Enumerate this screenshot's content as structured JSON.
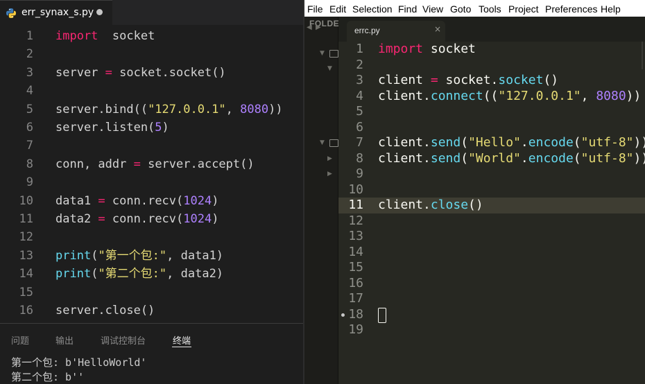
{
  "vscode": {
    "tab_label": "err_synax_s.py",
    "editor_lines": [
      {
        "n": "1",
        "t": [
          [
            "kw",
            "import"
          ],
          [
            "",
            "  socket"
          ]
        ]
      },
      {
        "n": "2",
        "t": []
      },
      {
        "n": "3",
        "t": [
          [
            "",
            "server "
          ],
          [
            "op",
            "="
          ],
          [
            "",
            " socket.socket()"
          ]
        ]
      },
      {
        "n": "4",
        "t": []
      },
      {
        "n": "5",
        "t": [
          [
            "",
            "server.bind(("
          ],
          [
            "st",
            "\"127.0.0.1\""
          ],
          [
            "",
            ", "
          ],
          [
            "nm",
            "8080"
          ],
          [
            "",
            "))"
          ]
        ]
      },
      {
        "n": "6",
        "t": [
          [
            "",
            "server.listen("
          ],
          [
            "nm",
            "5"
          ],
          [
            "",
            ")"
          ]
        ]
      },
      {
        "n": "7",
        "t": []
      },
      {
        "n": "8",
        "t": [
          [
            "",
            "conn, addr "
          ],
          [
            "op",
            "="
          ],
          [
            "",
            " server.accept()"
          ]
        ]
      },
      {
        "n": "9",
        "t": []
      },
      {
        "n": "10",
        "t": [
          [
            "",
            "data1 "
          ],
          [
            "op",
            "="
          ],
          [
            "",
            " conn.recv("
          ],
          [
            "nm",
            "1024"
          ],
          [
            "",
            ")"
          ]
        ]
      },
      {
        "n": "11",
        "t": [
          [
            "",
            "data2 "
          ],
          [
            "op",
            "="
          ],
          [
            "",
            " conn.recv("
          ],
          [
            "nm",
            "1024"
          ],
          [
            "",
            ")"
          ]
        ]
      },
      {
        "n": "12",
        "t": []
      },
      {
        "n": "13",
        "t": [
          [
            "fn",
            "print"
          ],
          [
            "",
            "("
          ],
          [
            "st",
            "\"第一个包:\""
          ],
          [
            "",
            ", data1)"
          ]
        ]
      },
      {
        "n": "14",
        "t": [
          [
            "fn",
            "print"
          ],
          [
            "",
            "("
          ],
          [
            "st",
            "\"第二个包:\""
          ],
          [
            "",
            ", data2)"
          ]
        ]
      },
      {
        "n": "15",
        "t": []
      },
      {
        "n": "16",
        "t": [
          [
            "",
            "server.close()"
          ]
        ]
      }
    ],
    "panel_tabs": [
      "问题",
      "输出",
      "调试控制台",
      "终端"
    ],
    "terminal_lines": [
      "第一个包: b'HelloWorld'",
      "第二个包: b''"
    ]
  },
  "sublime": {
    "menu": [
      "File",
      "Edit",
      "Selection",
      "Find",
      "View",
      "Goto",
      "Tools",
      "Project",
      "Preferences",
      "Help"
    ],
    "sidebar_label": "FOLDER",
    "tab_label": "errc.py",
    "tab_close": "×",
    "active_line": 11,
    "modified_line": 18,
    "editor_lines": [
      {
        "n": "1",
        "t": [
          [
            "kw",
            "import"
          ],
          [
            "",
            " socket"
          ]
        ]
      },
      {
        "n": "2",
        "t": []
      },
      {
        "n": "3",
        "t": [
          [
            "",
            "client "
          ],
          [
            "op",
            "="
          ],
          [
            "",
            " socket."
          ],
          [
            "fn",
            "socket"
          ],
          [
            "",
            "()"
          ]
        ]
      },
      {
        "n": "4",
        "t": [
          [
            "",
            "client."
          ],
          [
            "fn",
            "connect"
          ],
          [
            "",
            "(("
          ],
          [
            "st",
            "\"127.0.0.1\""
          ],
          [
            "",
            ", "
          ],
          [
            "nm",
            "8080"
          ],
          [
            "",
            "))"
          ]
        ]
      },
      {
        "n": "5",
        "t": []
      },
      {
        "n": "6",
        "t": []
      },
      {
        "n": "7",
        "t": [
          [
            "",
            "client."
          ],
          [
            "fn",
            "send"
          ],
          [
            "",
            "("
          ],
          [
            "st",
            "\"Hello\""
          ],
          [
            "",
            "."
          ],
          [
            "fn",
            "encode"
          ],
          [
            "",
            "("
          ],
          [
            "st",
            "\"utf-8\""
          ],
          [
            "",
            "))"
          ]
        ]
      },
      {
        "n": "8",
        "t": [
          [
            "",
            "client."
          ],
          [
            "fn",
            "send"
          ],
          [
            "",
            "("
          ],
          [
            "st",
            "\"World\""
          ],
          [
            "",
            "."
          ],
          [
            "fn",
            "encode"
          ],
          [
            "",
            "("
          ],
          [
            "st",
            "\"utf-8\""
          ],
          [
            "",
            "))"
          ]
        ]
      },
      {
        "n": "9",
        "t": []
      },
      {
        "n": "10",
        "t": []
      },
      {
        "n": "11",
        "t": [
          [
            "",
            "client."
          ],
          [
            "fn",
            "close"
          ],
          [
            "",
            "()"
          ]
        ]
      },
      {
        "n": "12",
        "t": []
      },
      {
        "n": "13",
        "t": []
      },
      {
        "n": "14",
        "t": []
      },
      {
        "n": "15",
        "t": []
      },
      {
        "n": "16",
        "t": []
      },
      {
        "n": "17",
        "t": []
      },
      {
        "n": "18",
        "t": []
      },
      {
        "n": "19",
        "t": []
      }
    ]
  },
  "colors": {
    "vscode_bg": "#1e1e1e",
    "sublime_bg": "#272822",
    "keyword": "#f92672",
    "function": "#66d9ef",
    "string": "#e6db74",
    "number": "#ae81ff"
  },
  "icons": {
    "python_file": "python-logo-icon",
    "modified_dot": "dot-icon",
    "close": "close-icon"
  }
}
